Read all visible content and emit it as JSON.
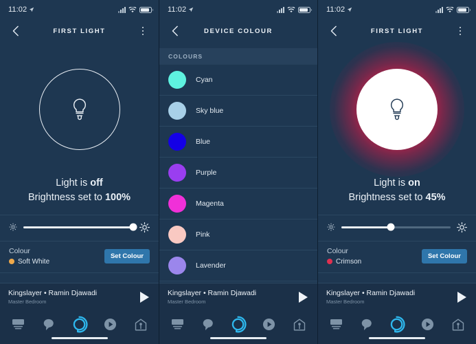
{
  "theme": {
    "bg": "#1e3751",
    "bg_dark": "#1b3048",
    "divider": "#2b4761",
    "accent_button": "#2f76ab",
    "alexa_blue": "#2eb8ee",
    "text": "#eaf0f6",
    "text_dim": "#7e93a7"
  },
  "status_bar": {
    "time": "11:02",
    "location_icon": "location-arrow-icon",
    "signal_icon": "cellular-signal-icon",
    "wifi_icon": "wifi-icon",
    "battery_icon": "battery-icon",
    "battery_level_pct": 85
  },
  "panels": [
    {
      "id": "device-detail-off",
      "nav": {
        "back_icon": "chevron-left-icon",
        "title": "FIRST LIGHT",
        "menu_icon": "overflow-menu-icon",
        "has_menu": true
      },
      "hero": {
        "bulb_icon": "light-bulb-icon",
        "power_on": false,
        "circle_style": "outline",
        "glow_colour": ""
      },
      "state": {
        "line1_prefix": "Light is ",
        "line1_value": "off",
        "line2_prefix": "Brightness set to ",
        "line2_value": "100%"
      },
      "brightness": {
        "low_icon": "brightness-low-icon",
        "high_icon": "brightness-high-icon",
        "value_pct": 100
      },
      "colour": {
        "label": "Colour",
        "value": "Soft White",
        "swatch_hex": "#efa94a",
        "button_label": "Set Colour"
      }
    },
    {
      "id": "device-colour-list",
      "nav": {
        "back_icon": "chevron-left-icon",
        "title": "DEVICE COLOUR",
        "menu_icon": "",
        "has_menu": false
      },
      "list_header": "COLOURS",
      "colours": [
        {
          "name": "Cyan",
          "hex": "#5ef2e0"
        },
        {
          "name": "Sky blue",
          "hex": "#a8d0e8"
        },
        {
          "name": "Blue",
          "hex": "#1400e6"
        },
        {
          "name": "Purple",
          "hex": "#9a3ef0"
        },
        {
          "name": "Magenta",
          "hex": "#f030d8"
        },
        {
          "name": "Pink",
          "hex": "#f9c9c2"
        },
        {
          "name": "Lavender",
          "hex": "#9b86ec"
        }
      ]
    },
    {
      "id": "device-detail-on",
      "nav": {
        "back_icon": "chevron-left-icon",
        "title": "FIRST LIGHT",
        "menu_icon": "overflow-menu-icon",
        "has_menu": true
      },
      "hero": {
        "bulb_icon": "light-bulb-icon",
        "power_on": true,
        "circle_style": "filled",
        "glow_colour": "#d81f49"
      },
      "state": {
        "line1_prefix": "Light is ",
        "line1_value": "on",
        "line2_prefix": "Brightness set to ",
        "line2_value": "45%"
      },
      "brightness": {
        "low_icon": "brightness-low-icon",
        "high_icon": "brightness-high-icon",
        "value_pct": 45
      },
      "colour": {
        "label": "Colour",
        "value": "Crimson",
        "swatch_hex": "#e03050",
        "button_label": "Set Colour"
      }
    }
  ],
  "media_bar": {
    "title": "Kingslayer • Ramin Djawadi",
    "subtitle": "Master Bedroom",
    "play_icon": "play-icon"
  },
  "tab_bar": {
    "items": [
      {
        "icon": "home-feed-icon",
        "active": false
      },
      {
        "icon": "communicate-bubble-icon",
        "active": false
      },
      {
        "icon": "alexa-ring-icon",
        "active": true
      },
      {
        "icon": "play-circle-icon",
        "active": false
      },
      {
        "icon": "devices-home-icon",
        "active": false
      }
    ]
  },
  "home_indicator": "home-indicator-bar"
}
